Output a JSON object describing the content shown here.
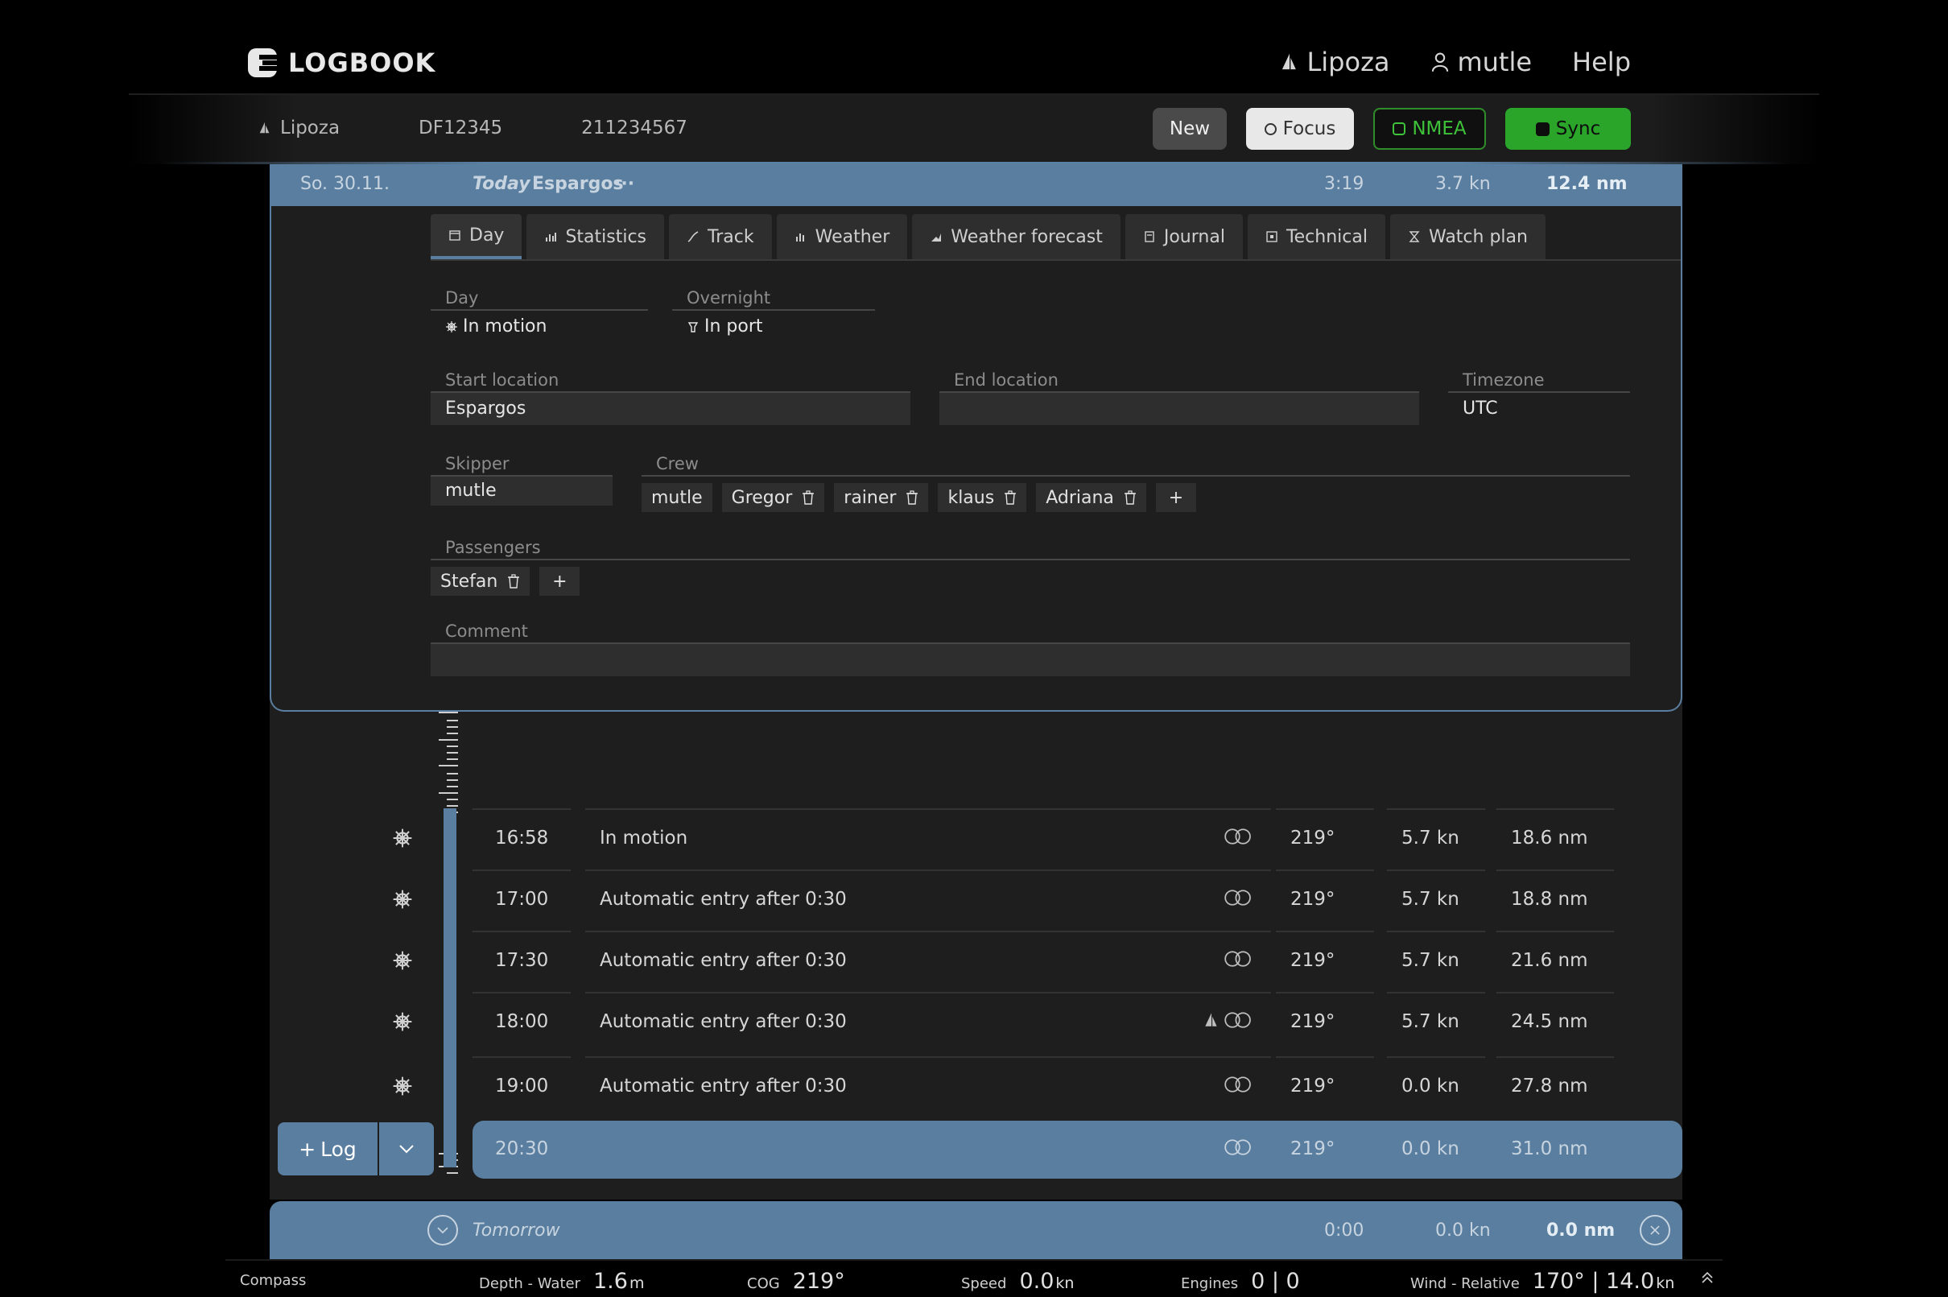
{
  "app": {
    "logo_text": "LOGBOOK",
    "nav": {
      "boat": "Lipoza",
      "user": "mutle",
      "help": "Help"
    }
  },
  "subbar": {
    "boat": "Lipoza",
    "callsign": "DF12345",
    "mmsi": "211234567",
    "buttons": {
      "new": "New",
      "focus": "Focus",
      "nmea": "NMEA",
      "sync": "Sync"
    }
  },
  "day_header": {
    "date": "So. 30.11.",
    "today": "Today",
    "location": "Espargos",
    "more": "···",
    "duration": "3:19",
    "avg_speed": "3.7 kn",
    "distance": "12.4 nm"
  },
  "tabs": [
    "Day",
    "Statistics",
    "Track",
    "Weather",
    "Weather forecast",
    "Journal",
    "Technical",
    "Watch plan"
  ],
  "day_form": {
    "day_label": "Day",
    "day_value": "In motion",
    "overnight_label": "Overnight",
    "overnight_value": "In port",
    "start_label": "Start location",
    "start_value": "Espargos",
    "end_label": "End location",
    "end_value": "",
    "tz_label": "Timezone",
    "tz_value": "UTC",
    "skipper_label": "Skipper",
    "skipper_value": "mutle",
    "crew_label": "Crew",
    "crew": [
      "mutle",
      "Gregor",
      "rainer",
      "klaus",
      "Adriana"
    ],
    "passengers_label": "Passengers",
    "passengers": [
      "Stefan"
    ],
    "comment_label": "Comment",
    "comment_value": "",
    "add": "+"
  },
  "entries": [
    {
      "time": "16:58",
      "text": "In motion",
      "cog": "219°",
      "speed": "5.7 kn",
      "distance": "18.6 nm"
    },
    {
      "time": "17:00",
      "text": "Automatic entry after 0:30",
      "cog": "219°",
      "speed": "5.7 kn",
      "distance": "18.8 nm"
    },
    {
      "time": "17:30",
      "text": "Automatic entry after 0:30",
      "cog": "219°",
      "speed": "5.7 kn",
      "distance": "21.6 nm"
    },
    {
      "time": "18:00",
      "text": "Automatic entry after 0:30",
      "cog": "219°",
      "speed": "5.7 kn",
      "distance": "24.5 nm"
    },
    {
      "time": "19:00",
      "text": "Automatic entry after 0:30",
      "cog": "219°",
      "speed": "0.0 kn",
      "distance": "27.8 nm"
    },
    {
      "time": "20:30",
      "text": "",
      "cog": "219°",
      "speed": "0.0 kn",
      "distance": "31.0 nm"
    }
  ],
  "log_button": {
    "label": "Log",
    "plus": "+"
  },
  "tomorrow": {
    "label": "Tomorrow",
    "duration": "0:00",
    "avg_speed": "0.0 kn",
    "distance": "0.0 nm"
  },
  "status": {
    "compass": "Compass",
    "depth_label": "Depth - Water",
    "depth_value": "1.6",
    "depth_unit": "m",
    "cog_label": "COG",
    "cog_value": "219°",
    "speed_label": "Speed",
    "speed_value": "0.0",
    "speed_unit": "kn",
    "engines_label": "Engines",
    "engines_value": "0 | 0",
    "wind_label": "Wind - Relative",
    "wind_value": "170° | 14.0",
    "wind_unit": "kn"
  },
  "colors": {
    "accent": "#5a7e9f",
    "sync": "#2aa52a",
    "nmea": "#3ec23a",
    "panel": "#1e1e1e"
  }
}
